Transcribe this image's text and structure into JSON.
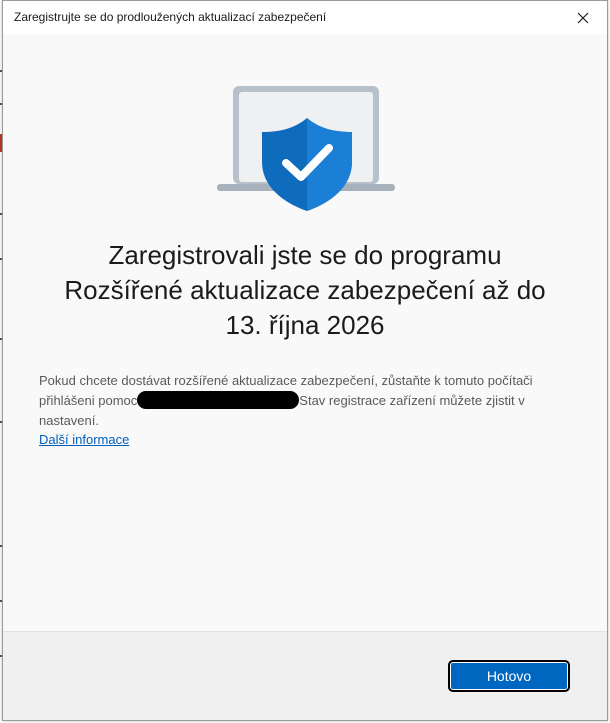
{
  "dialog": {
    "title": "Zaregistrujte se do prodloužených aktualizací zabezpečení",
    "close_icon": "close-icon",
    "hero_icon": "laptop-shield-check-icon"
  },
  "content": {
    "headline_lines": [
      "Zaregistrovali jste se do programu",
      "Rozšířené aktualizace zabezpečení až do",
      "13. října 2026"
    ],
    "body_line1": "Pokud chcete dostávat rozšířené aktualizace zabezpečení, zůstaňte k tomuto počítači",
    "body_line2_before": "přihlášeni pomoc",
    "body_line2_after": "Stav registrace zařízení můžete zjistit v",
    "body_line3": "nastavení.",
    "more_info_link": "Další informace"
  },
  "footer": {
    "done_button": "Hotovo"
  },
  "colors": {
    "accent": "#0067c0",
    "link": "#005fb8",
    "shield": "#0f6cbd"
  }
}
